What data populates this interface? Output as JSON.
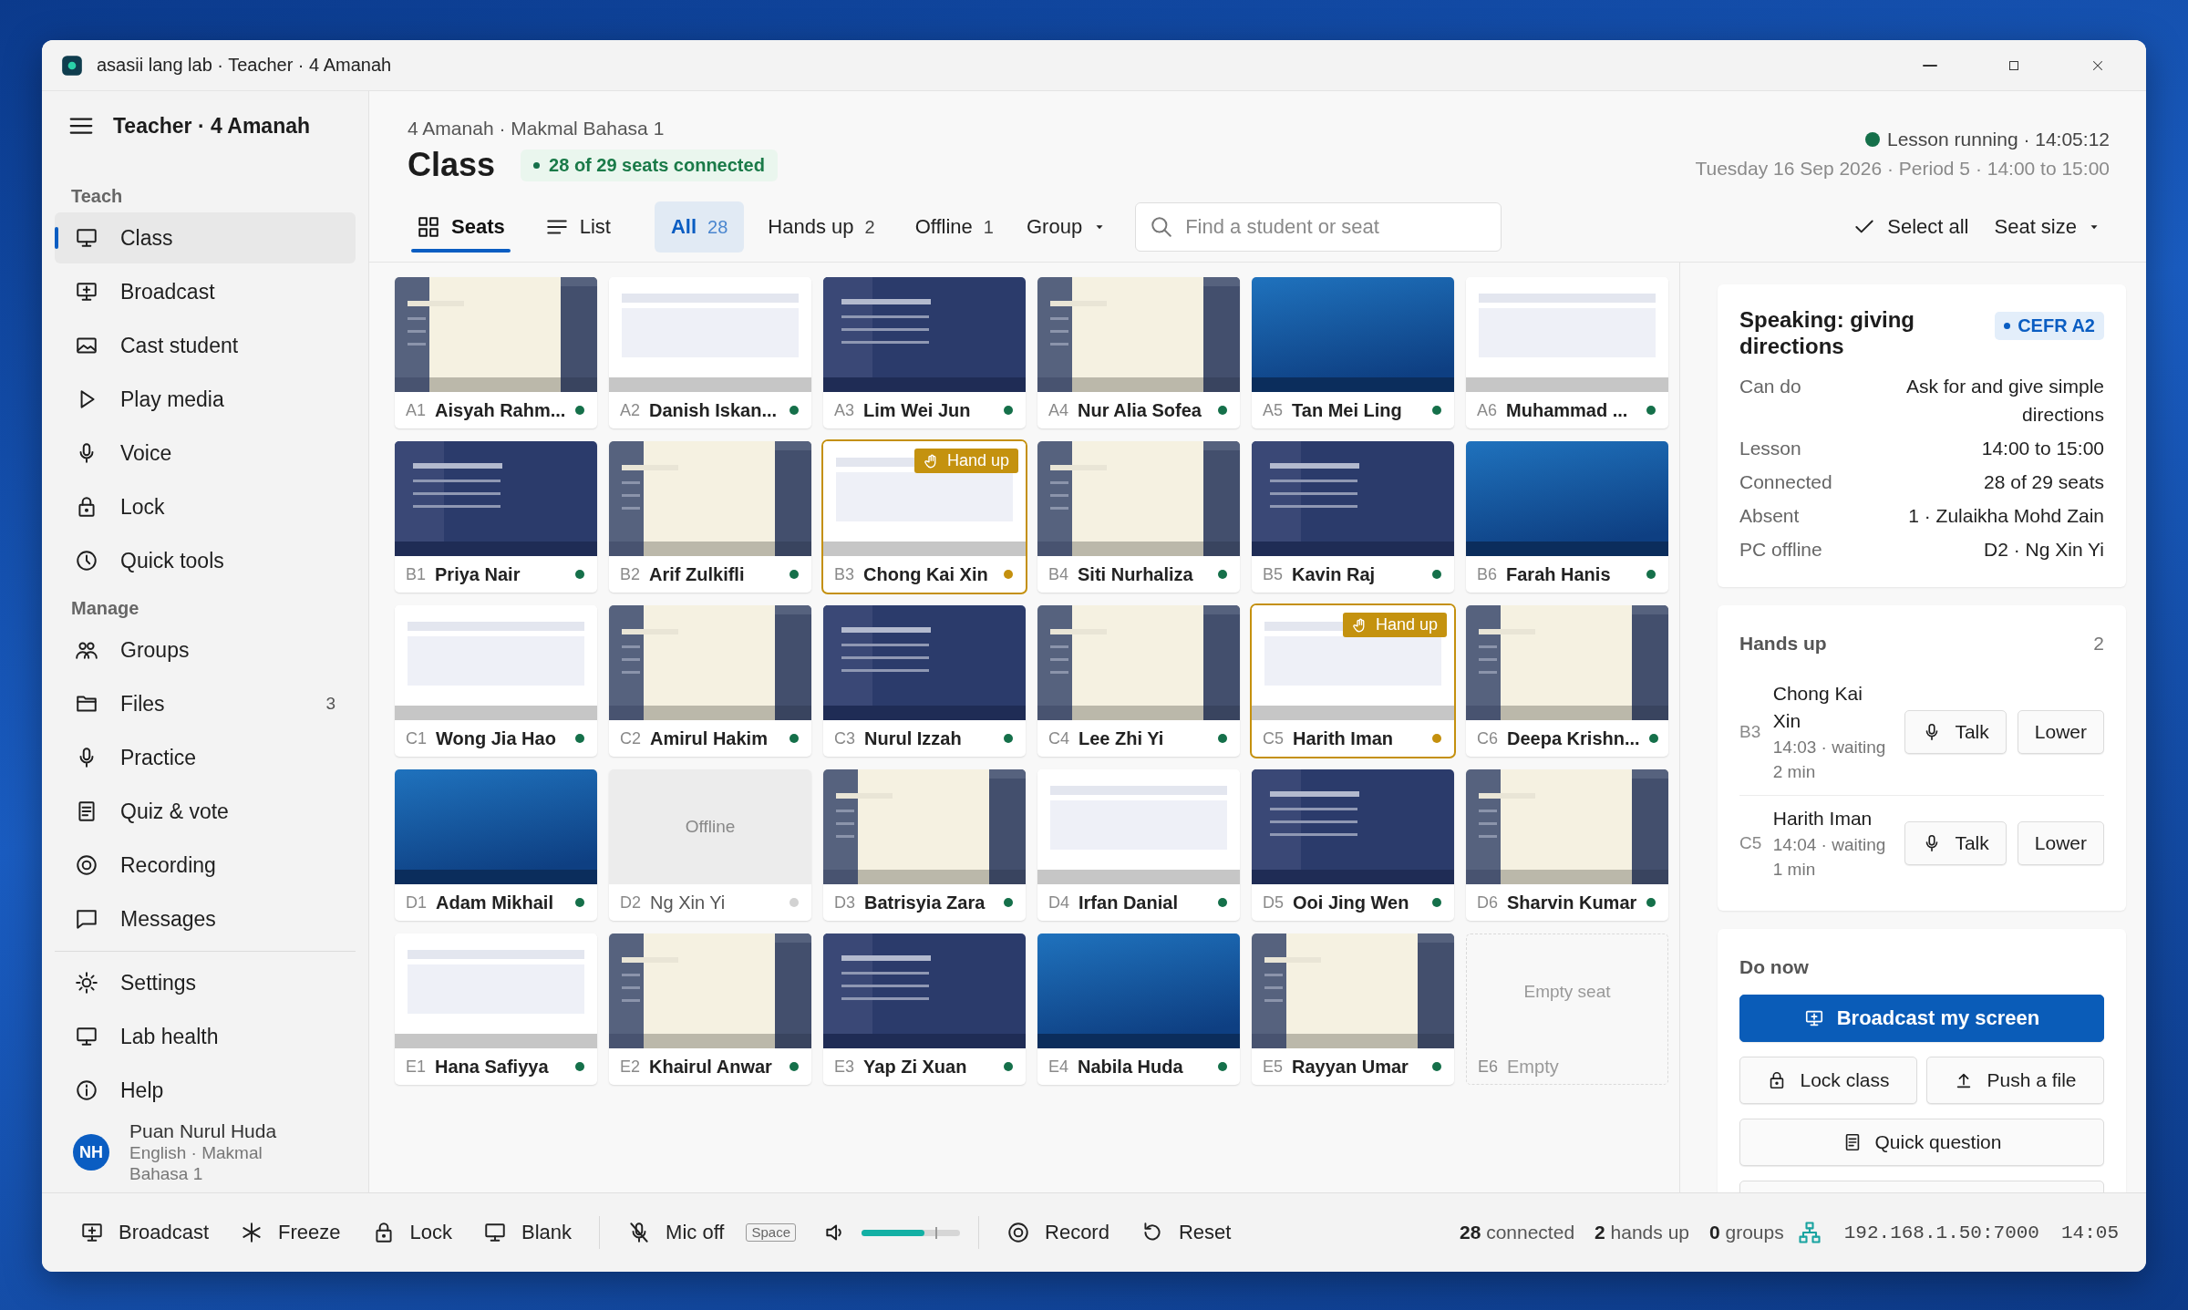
{
  "window": {
    "title": "asasii lang lab · Teacher · 4 Amanah"
  },
  "sidebar": {
    "title": "Teacher · 4 Amanah",
    "sections": [
      {
        "heading": "Teach",
        "items": [
          {
            "label": "Class",
            "selected": true
          },
          {
            "label": "Broadcast",
            "selected": false
          },
          {
            "label": "Cast student",
            "selected": false
          },
          {
            "label": "Play media",
            "selected": false
          },
          {
            "label": "Voice",
            "selected": false
          },
          {
            "label": "Lock",
            "selected": false
          },
          {
            "label": "Quick tools",
            "selected": false
          }
        ]
      },
      {
        "heading": "Manage",
        "items": [
          {
            "label": "Groups",
            "selected": false
          },
          {
            "label": "Files",
            "selected": false,
            "count": "3"
          },
          {
            "label": "Practice",
            "selected": false
          },
          {
            "label": "Quiz & vote",
            "selected": false
          },
          {
            "label": "Recording",
            "selected": false
          },
          {
            "label": "Messages",
            "selected": false
          }
        ]
      }
    ],
    "footer_items": [
      {
        "label": "Settings",
        "selected": false
      },
      {
        "label": "Lab health",
        "selected": false
      },
      {
        "label": "Help",
        "selected": false
      }
    ],
    "user": {
      "initials": "NH",
      "name": "Puan Nurul Huda",
      "role": "English · Makmal Bahasa 1"
    }
  },
  "header": {
    "breadcrumb": "4 Amanah · Makmal Bahasa 1",
    "title": "Class",
    "connection": "28 of 29 seats connected",
    "lesson_status": "Lesson running · 14:05:12",
    "schedule": "Tuesday 16 Sep 2026 · Period 5 · 14:00 to 15:00"
  },
  "toolbar": {
    "views": [
      {
        "label": "Seats",
        "selected": true
      },
      {
        "label": "List",
        "selected": false
      }
    ],
    "filters": [
      {
        "label": "All",
        "count": "28",
        "selected": true
      },
      {
        "label": "Hands up",
        "count": "2",
        "selected": false
      },
      {
        "label": "Offline",
        "count": "1",
        "selected": false
      }
    ],
    "group_menu": "Group",
    "search": {
      "placeholder": "Find a student or seat"
    },
    "select_all": "Select all",
    "seat_size": "Seat size"
  },
  "seats": [
    {
      "seat": "A1",
      "name": "Aisyah Rahm...",
      "kind": "doc",
      "hand_up": false
    },
    {
      "seat": "A2",
      "name": "Danish Iskan...",
      "kind": "blank",
      "hand_up": false
    },
    {
      "seat": "A3",
      "name": "Lim Wei Jun",
      "kind": "slides",
      "hand_up": false
    },
    {
      "seat": "A4",
      "name": "Nur Alia Sofea",
      "kind": "doc",
      "hand_up": false
    },
    {
      "seat": "A5",
      "name": "Tan Mei Ling",
      "kind": "video",
      "hand_up": false
    },
    {
      "seat": "A6",
      "name": "Muhammad ...",
      "kind": "blank",
      "hand_up": false
    },
    {
      "seat": "B1",
      "name": "Priya Nair",
      "kind": "slides",
      "hand_up": false
    },
    {
      "seat": "B2",
      "name": "Arif Zulkifli",
      "kind": "doc",
      "hand_up": false
    },
    {
      "seat": "B3",
      "name": "Chong Kai Xin",
      "kind": "blank",
      "hand_up": true,
      "badge": "Hand up"
    },
    {
      "seat": "B4",
      "name": "Siti Nurhaliza",
      "kind": "doc",
      "hand_up": false
    },
    {
      "seat": "B5",
      "name": "Kavin Raj",
      "kind": "slides",
      "hand_up": false
    },
    {
      "seat": "B6",
      "name": "Farah Hanis",
      "kind": "video",
      "hand_up": false
    },
    {
      "seat": "C1",
      "name": "Wong Jia Hao",
      "kind": "blank",
      "hand_up": false
    },
    {
      "seat": "C2",
      "name": "Amirul Hakim",
      "kind": "doc",
      "hand_up": false
    },
    {
      "seat": "C3",
      "name": "Nurul Izzah",
      "kind": "slides",
      "hand_up": false
    },
    {
      "seat": "C4",
      "name": "Lee Zhi Yi",
      "kind": "doc",
      "hand_up": false
    },
    {
      "seat": "C5",
      "name": "Harith Iman",
      "kind": "blank",
      "hand_up": true,
      "badge": "Hand up"
    },
    {
      "seat": "C6",
      "name": "Deepa Krishn...",
      "kind": "doc",
      "hand_up": false
    },
    {
      "seat": "D1",
      "name": "Adam Mikhail",
      "kind": "video",
      "hand_up": false
    },
    {
      "seat": "D2",
      "name": "Ng Xin Yi",
      "kind": "offline",
      "screen_text": "Offline",
      "hand_up": false
    },
    {
      "seat": "D3",
      "name": "Batrisyia Zara",
      "kind": "doc",
      "hand_up": false
    },
    {
      "seat": "D4",
      "name": "Irfan Danial",
      "kind": "blank",
      "hand_up": false
    },
    {
      "seat": "D5",
      "name": "Ooi Jing Wen",
      "kind": "slides",
      "hand_up": false
    },
    {
      "seat": "D6",
      "name": "Sharvin Kumar",
      "kind": "doc",
      "hand_up": false
    },
    {
      "seat": "E1",
      "name": "Hana Safiyya",
      "kind": "blank",
      "hand_up": false
    },
    {
      "seat": "E2",
      "name": "Khairul Anwar",
      "kind": "doc",
      "hand_up": false
    },
    {
      "seat": "E3",
      "name": "Yap Zi Xuan",
      "kind": "slides",
      "hand_up": false
    },
    {
      "seat": "E4",
      "name": "Nabila Huda",
      "kind": "video",
      "hand_up": false
    },
    {
      "seat": "E5",
      "name": "Rayyan Umar",
      "kind": "doc",
      "hand_up": false
    },
    {
      "seat": "E6",
      "name": "Empty",
      "kind": "empty",
      "screen_text": "Empty seat",
      "hand_up": false
    }
  ],
  "lesson_card": {
    "title": "Speaking: giving directions",
    "tag": "CEFR A2",
    "rows": [
      {
        "label": "Can do",
        "value": "Ask for and give simple directions"
      },
      {
        "label": "Lesson",
        "value": "14:00 to 15:00"
      },
      {
        "label": "Connected",
        "value": "28 of 29 seats"
      },
      {
        "label": "Absent",
        "value": "1 · Zulaikha Mohd Zain"
      },
      {
        "label": "PC offline",
        "value": "D2 · Ng Xin Yi"
      }
    ]
  },
  "hands_up": {
    "title": "Hands up",
    "count": "2",
    "entries": [
      {
        "seat": "B3",
        "name": "Chong Kai Xin",
        "detail": "14:03 · waiting 2 min",
        "talk": "Talk",
        "lower": "Lower"
      },
      {
        "seat": "C5",
        "name": "Harith Iman",
        "detail": "14:04 · waiting 1 min",
        "talk": "Talk",
        "lower": "Lower"
      }
    ]
  },
  "do_now": {
    "title": "Do now",
    "buttons": [
      {
        "label": "Broadcast my screen",
        "kind": "primary"
      },
      {
        "label": "Lock class",
        "kind": "normal"
      },
      {
        "label": "Push a file",
        "kind": "normal"
      },
      {
        "label": "Quick question",
        "kind": "normal"
      }
    ]
  },
  "bottom_bar": {
    "tools": [
      "Broadcast",
      "Freeze",
      "Lock",
      "Blank"
    ],
    "mic": {
      "label": "Mic off",
      "shortcut": "Space"
    },
    "volume": {
      "level": 0.64
    },
    "session": [
      "Record",
      "Reset"
    ],
    "stats": [
      "**28** connected",
      "**2** hands up",
      "**0** groups"
    ],
    "address": "192.168.1.50:7000",
    "clock": "14:05"
  }
}
